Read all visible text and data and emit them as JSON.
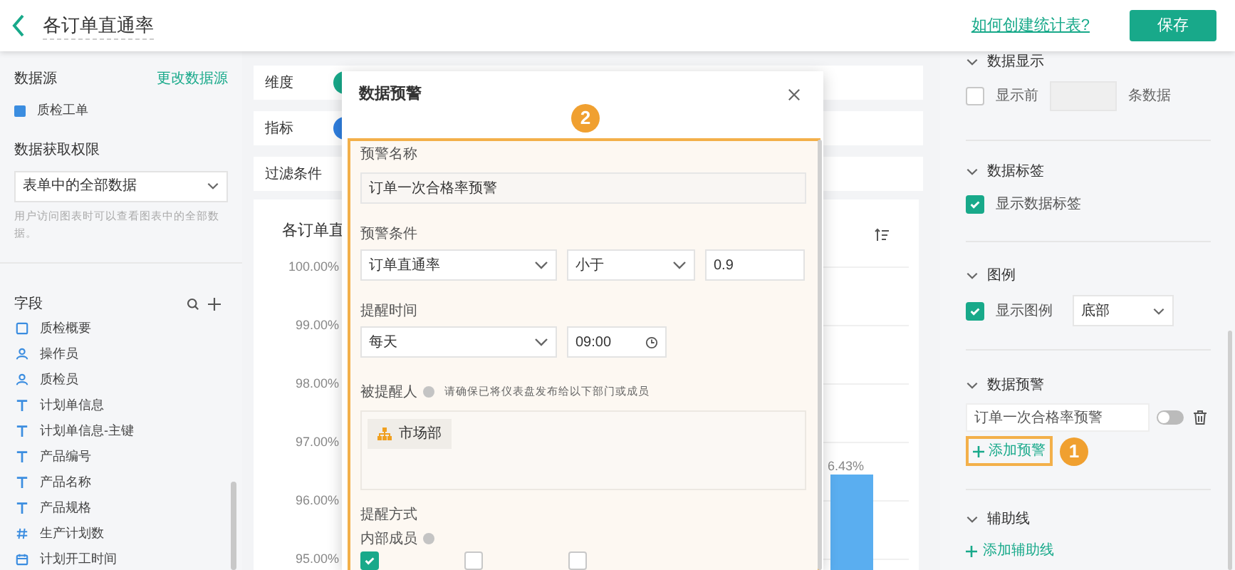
{
  "header": {
    "title": "各订单直通率",
    "help_link": "如何创建统计表?",
    "save_button": "保存"
  },
  "sidebar": {
    "datasource_label": "数据源",
    "change_link": "更改数据源",
    "datasource": {
      "label": "质检工单",
      "checked": true
    },
    "permission_label": "数据获取权限",
    "permission_select": "表单中的全部数据",
    "permission_hint": "用户访问图表时可以查看图表中的全部数据。",
    "fields_label": "字段",
    "fields": [
      {
        "kind": "form",
        "label": "质检概要"
      },
      {
        "kind": "member",
        "label": "操作员"
      },
      {
        "kind": "member",
        "label": "质检员"
      },
      {
        "kind": "text",
        "label": "计划单信息"
      },
      {
        "kind": "text",
        "label": "计划单信息-主键"
      },
      {
        "kind": "text",
        "label": "产品编号"
      },
      {
        "kind": "text",
        "label": "产品名称"
      },
      {
        "kind": "text",
        "label": "产品规格"
      },
      {
        "kind": "number",
        "label": "生产计划数"
      },
      {
        "kind": "date",
        "label": "计划开工时间"
      }
    ]
  },
  "config_rows": [
    {
      "label": "维度",
      "color": "#18a98a"
    },
    {
      "label": "指标",
      "color": "#2f7fe0"
    },
    {
      "label": "过滤条件"
    }
  ],
  "chart": {
    "title": "各订单直",
    "yticks": [
      "100.00%",
      "99.00%",
      "98.00%",
      "97.00%",
      "96.00%",
      "95.00%"
    ],
    "bar_label": "6.43%"
  },
  "dialog": {
    "title": "数据预警",
    "badge": "2",
    "name_label": "预警名称",
    "name_value": "订单一次合格率预警",
    "condition_label": "预警条件",
    "condition_field": "订单直通率",
    "condition_operator": "小于",
    "condition_value": "0.9",
    "time_label": "提醒时间",
    "time_frequency": "每天",
    "time_value": "09:00",
    "recipients_label": "被提醒人",
    "recipients_hint": "请确保已将仪表盘发布给以下部门或成员",
    "recipients": [
      "市场部"
    ],
    "method_label": "提醒方式",
    "internal_label": "内部成员",
    "methods": [
      {
        "checked": true
      },
      {
        "checked": false
      },
      {
        "checked": false
      }
    ]
  },
  "settings": {
    "display": {
      "title": "数据显示",
      "checked": false,
      "prefix": "显示前",
      "suffix": "条数据"
    },
    "labels": {
      "title": "数据标签",
      "checkbox": "显示数据标签",
      "checked": true
    },
    "legend": {
      "title": "图例",
      "checkbox": "显示图例",
      "checked": true,
      "position": "底部"
    },
    "alerts": {
      "title": "数据预警",
      "items": [
        {
          "name": "订单一次合格率预警",
          "on": false
        }
      ],
      "add_button": "添加预警",
      "badge": "1"
    },
    "guides": {
      "title": "辅助线",
      "add_button": "添加辅助线"
    }
  }
}
